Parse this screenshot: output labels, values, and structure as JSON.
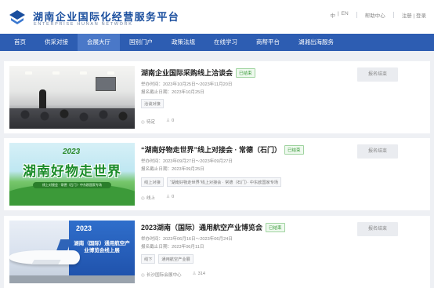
{
  "brand": {
    "title_cn": "湖南企业国际化经营服务平台",
    "title_en": "ENTERPRISE HUNAN NETWORK"
  },
  "top_links": {
    "lang_cn": "中",
    "lang_sep": "|",
    "lang_en": "EN",
    "help": "帮助中心",
    "login_register": "注册 | 登录"
  },
  "nav": {
    "items": [
      {
        "label": "首页"
      },
      {
        "label": "供采对接"
      },
      {
        "label": "会展大厅"
      },
      {
        "label": "国别门户"
      },
      {
        "label": "政策法规"
      },
      {
        "label": "在线学习"
      },
      {
        "label": "商帮平台"
      },
      {
        "label": "湖湘出海服务"
      }
    ],
    "active_index": 2
  },
  "events": [
    {
      "title": "湖南企业国际采购线上洽谈会",
      "status": "已结束",
      "date": "举办时间：2023年10月25日～2023年11月20日",
      "deadline": "报名截止日期：2023年10月25日",
      "tags": [
        "洽谈对接"
      ],
      "views": "待定",
      "count": "0",
      "button": "报名结束"
    },
    {
      "title": "“湖南好物走世界”线上对接会 · 常德（石门）",
      "status": "已结束",
      "date": "举办时间：2023年09月27日～2023年09月27日",
      "deadline": "报名截止日期：2023年09月25日",
      "tags": [
        "线上对接",
        "“湖南好物走世界”线上对接会 · 常德（石门）· 中东欧国家专场"
      ],
      "views": "线上",
      "count": "0",
      "button": "报名结束",
      "thumb_big": "湖南好物走世界",
      "thumb_year": "2023",
      "thumb_tag": "线上对接会 · 常德（石门）· 中东欧国家专场"
    },
    {
      "title": "2023湖南（国际）通用航空产业博览会",
      "status": "已结束",
      "date": "举办时间：2023年06月16日～2023年06月24日",
      "deadline": "报名截止日期：2023年06月11日",
      "tags": [
        "线下",
        "通用航空产业展"
      ],
      "views": "长沙国际会展中心",
      "count": "314",
      "button": "报名结束",
      "thumb_year": "2023",
      "thumb_text": "湖南（国际）通用航空产业博览会线上展"
    }
  ]
}
